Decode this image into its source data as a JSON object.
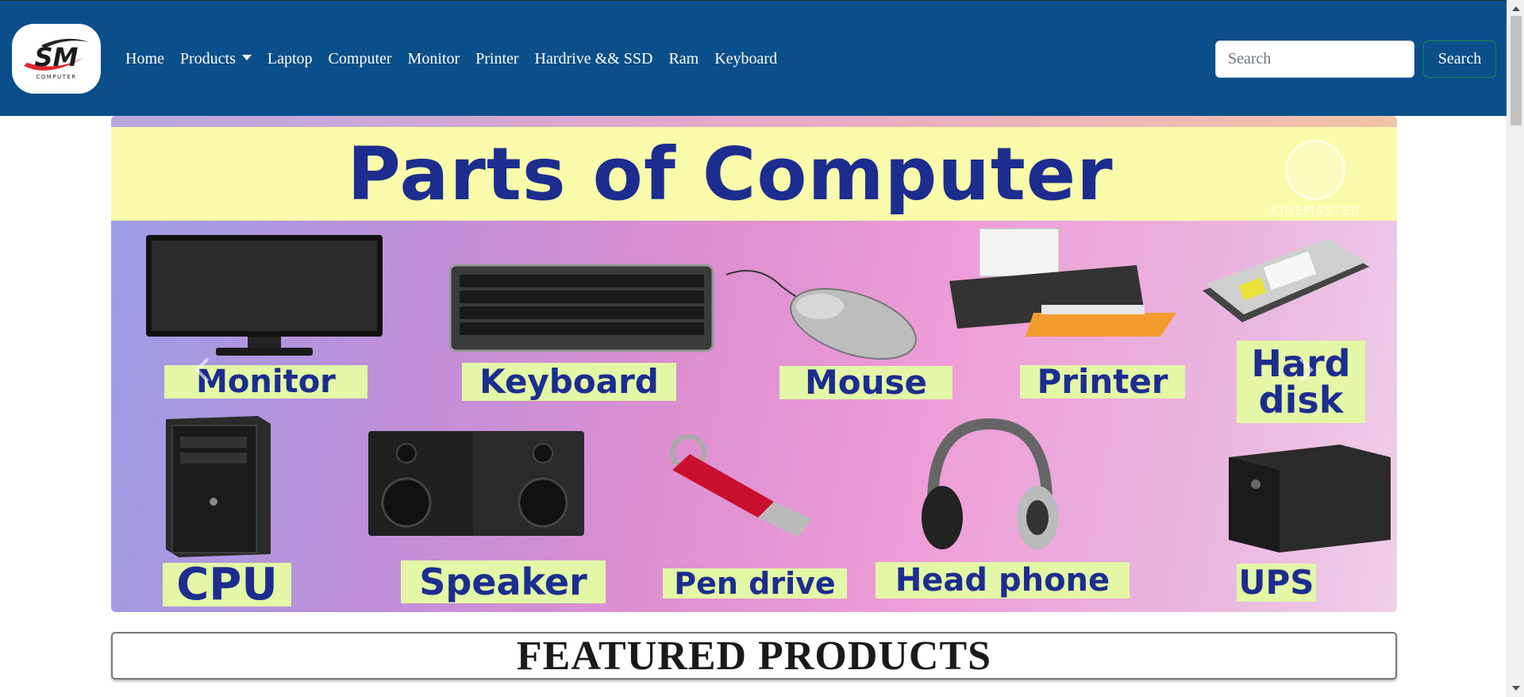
{
  "brand": {
    "logo_text": "SM",
    "logo_subtext": "COMPUTER",
    "accent": "#e2262e",
    "navbar_bg": "#0a4f8a"
  },
  "nav": {
    "items": [
      {
        "label": "Home"
      },
      {
        "label": "Products"
      },
      {
        "label": "Laptop"
      },
      {
        "label": "Computer"
      },
      {
        "label": "Monitor"
      },
      {
        "label": "Printer"
      },
      {
        "label": "Hardrive && SSD"
      },
      {
        "label": "Ram"
      },
      {
        "label": "Keyboard"
      }
    ]
  },
  "search": {
    "placeholder": "Search",
    "button_label": "Search"
  },
  "banner": {
    "title": "Parts of Computer",
    "watermark": "KINEMASTER",
    "parts": [
      {
        "label": "Monitor",
        "icon": "monitor-icon"
      },
      {
        "label": "Keyboard",
        "icon": "keyboard-icon"
      },
      {
        "label": "Mouse",
        "icon": "mouse-icon"
      },
      {
        "label": "Printer",
        "icon": "printer-icon"
      },
      {
        "label": "Hard disk",
        "icon": "hard-disk-icon"
      },
      {
        "label": "CPU",
        "icon": "cpu-icon"
      },
      {
        "label": "Speaker",
        "icon": "speaker-icon"
      },
      {
        "label": "Pen drive",
        "icon": "pen-drive-icon"
      },
      {
        "label": "Head phone",
        "icon": "headphone-icon"
      },
      {
        "label": "UPS",
        "icon": "ups-icon"
      }
    ]
  },
  "featured": {
    "title": "FEATURED PRODUCTS"
  }
}
